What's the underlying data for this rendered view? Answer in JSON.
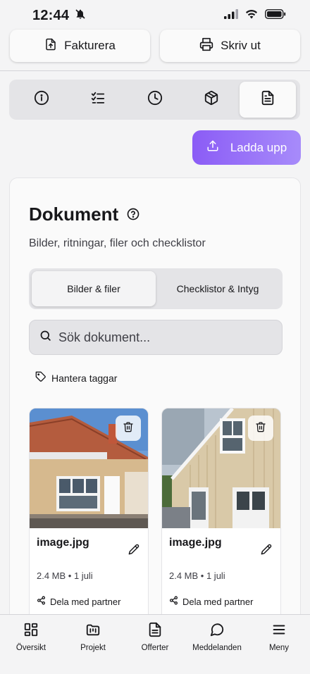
{
  "status": {
    "time": "12:44"
  },
  "top_actions": {
    "invoice_label": "Fakturera",
    "print_label": "Skriv ut"
  },
  "tabs": [
    {
      "icon": "info-icon"
    },
    {
      "icon": "checklist-icon"
    },
    {
      "icon": "clock-icon"
    },
    {
      "icon": "package-icon"
    },
    {
      "icon": "document-icon",
      "active": true
    }
  ],
  "upload": {
    "label": "Ladda upp"
  },
  "documents": {
    "title": "Dokument",
    "subtitle": "Bilder, ritningar, filer och checklistor",
    "segments": [
      "Bilder & filer",
      "Checklistor & Intyg"
    ],
    "search_placeholder": "Sök dokument...",
    "manage_tags": "Hantera taggar",
    "files": [
      {
        "name": "image.jpg",
        "meta": "2.4 MB • 1 juli",
        "share": "Dela med partner"
      },
      {
        "name": "image.jpg",
        "meta": "2.4 MB • 1 juli",
        "share": "Dela med partner"
      }
    ]
  },
  "bottom_nav": [
    "Översikt",
    "Projekt",
    "Offerter",
    "Meddelanden",
    "Meny"
  ],
  "colors": {
    "accent": "#8b5cf6",
    "background": "#f4f4f5"
  }
}
